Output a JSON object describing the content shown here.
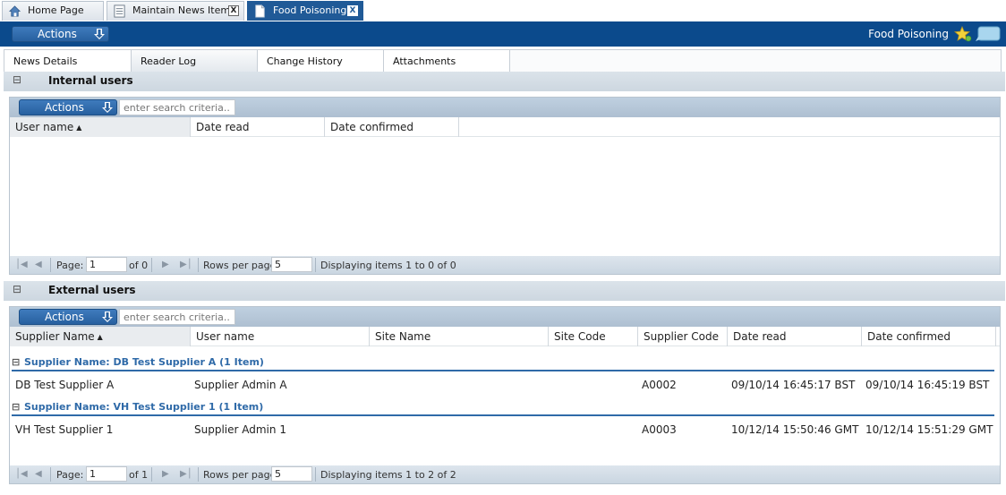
{
  "tabs": [
    {
      "label": "Home Page",
      "icon": "home-icon"
    },
    {
      "label": "Maintain News Items",
      "icon": "document-list-icon"
    },
    {
      "label": "Food Poisoning",
      "icon": "document-icon"
    }
  ],
  "close_glyph": "X",
  "topbar": {
    "actions_label": "Actions",
    "title": "Food Poisoning",
    "colors": {
      "bar": "#0b4a8c",
      "button": "#2f6aa8"
    }
  },
  "subtabs": [
    "News Details",
    "Reader Log",
    "Change History",
    "Attachments"
  ],
  "internal": {
    "section_label": "Internal users",
    "collapse_glyph": "⊟",
    "actions_label": "Actions",
    "search_placeholder": "enter search criteria..",
    "columns": [
      "User name",
      "Date read",
      "Date confirmed"
    ],
    "pager": {
      "page_label": "Page:",
      "page_value": "1",
      "of_label": "of 0",
      "rows_label": "Rows per page",
      "rows_value": "5",
      "display": "Displaying items 1 to 0 of 0"
    }
  },
  "external": {
    "section_label": "External users",
    "collapse_glyph": "⊟",
    "actions_label": "Actions",
    "search_placeholder": "enter search criteria..",
    "columns": [
      "Supplier Name",
      "User name",
      "Site Name",
      "Site Code",
      "Supplier Code",
      "Date read",
      "Date confirmed"
    ],
    "groups": [
      {
        "header": "Supplier Name: DB Test Supplier A (1 Item)",
        "row": {
          "supplier": "DB Test Supplier A",
          "user": "Supplier Admin A",
          "site_name": "",
          "site_code": "",
          "supplier_code": "A0002",
          "date_read": "09/10/14 16:45:17 BST",
          "date_confirmed": "09/10/14 16:45:19 BST"
        }
      },
      {
        "header": "Supplier Name: VH Test Supplier 1 (1 Item)",
        "row": {
          "supplier": "VH Test Supplier 1",
          "user": "Supplier Admin 1",
          "site_name": "",
          "site_code": "",
          "supplier_code": "A0003",
          "date_read": "10/12/14 15:50:46 GMT",
          "date_confirmed": "10/12/14 15:51:29 GMT"
        }
      }
    ],
    "pager": {
      "page_label": "Page:",
      "page_value": "1",
      "of_label": "of 1",
      "rows_label": "Rows per page",
      "rows_value": "5",
      "display": "Displaying items 1 to 2 of 2"
    }
  }
}
